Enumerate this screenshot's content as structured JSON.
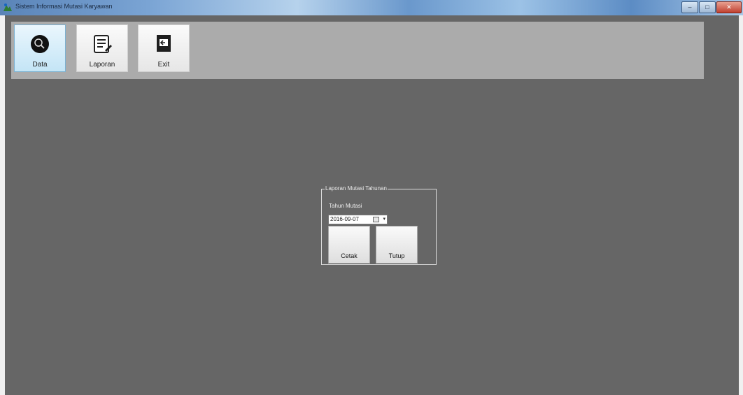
{
  "window": {
    "title": "Sistem Informasi Mutasi Karyawan",
    "controls": {
      "minimize": "–",
      "maximize": "□",
      "close": "✕"
    }
  },
  "toolbar": {
    "items": [
      {
        "label": "Data",
        "icon": "data-icon",
        "active": true
      },
      {
        "label": "Laporan",
        "icon": "report-icon",
        "active": false
      },
      {
        "label": "Exit",
        "icon": "exit-icon",
        "active": false
      }
    ]
  },
  "report_dialog": {
    "group_title": "Laporan Mutasi Tahunan",
    "field_label": "Tahun Mutasi",
    "date_value": "2016-09-07",
    "print_button": "Cetak",
    "close_button": "Tutup"
  },
  "colors": {
    "client_background": "#666666",
    "toolbar_background": "#ababab",
    "active_button": "#c4e5f6"
  }
}
